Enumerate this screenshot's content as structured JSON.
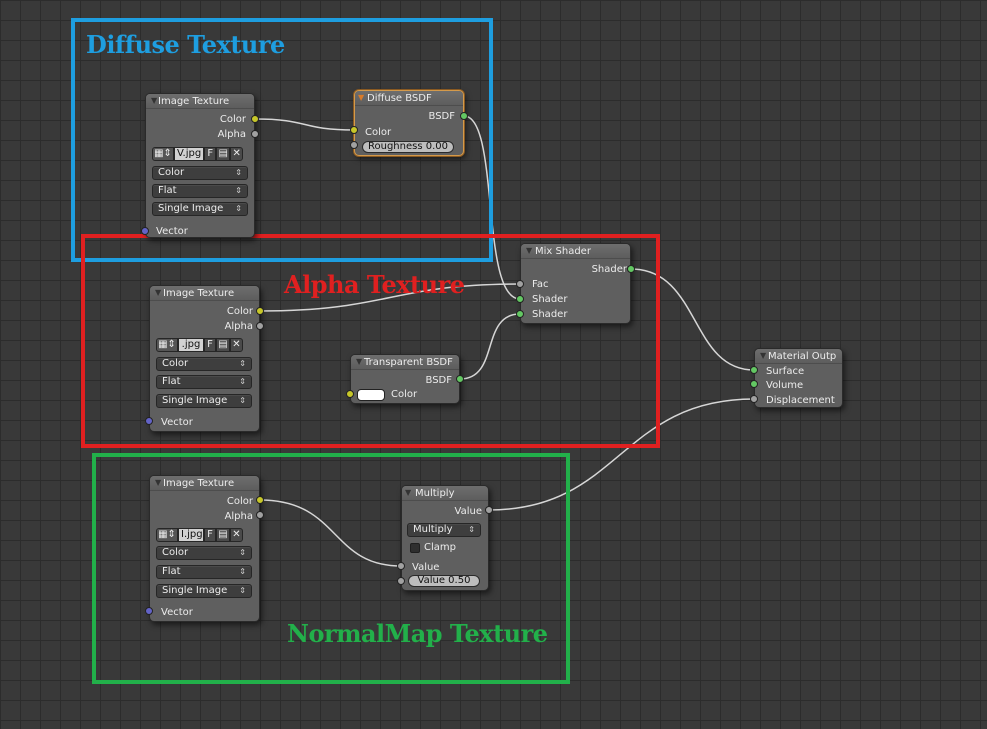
{
  "frames": {
    "diffuse": {
      "title": "Diffuse Texture",
      "color": "#1e9ee0"
    },
    "alpha": {
      "title": "Alpha Texture",
      "color": "#e02020"
    },
    "normal": {
      "title": "NormalMap Texture",
      "color": "#22b04a"
    }
  },
  "nodes": {
    "image_texture_1": {
      "title": "Image Texture",
      "outputs": {
        "color": "Color",
        "alpha": "Alpha"
      },
      "image_name": "V.jpg",
      "fake_user": "F",
      "color_space": "Color",
      "projection": "Flat",
      "source": "Single Image",
      "input_vector": "Vector"
    },
    "image_texture_2": {
      "title": "Image Texture",
      "outputs": {
        "color": "Color",
        "alpha": "Alpha"
      },
      "image_name": ".jpg",
      "fake_user": "F",
      "color_space": "Color",
      "projection": "Flat",
      "source": "Single Image",
      "input_vector": "Vector"
    },
    "image_texture_3": {
      "title": "Image Texture",
      "outputs": {
        "color": "Color",
        "alpha": "Alpha"
      },
      "image_name": "I.jpg",
      "fake_user": "F",
      "color_space": "Color",
      "projection": "Flat",
      "source": "Single Image",
      "input_vector": "Vector"
    },
    "diffuse_bsdf": {
      "title": "Diffuse BSDF",
      "output": "BSDF",
      "input_color": "Color",
      "roughness": "Roughness 0.00"
    },
    "mix_shader": {
      "title": "Mix Shader",
      "output": "Shader",
      "inputs": [
        "Fac",
        "Shader",
        "Shader"
      ]
    },
    "transparent_bsdf": {
      "title": "Transparent BSDF",
      "output": "BSDF",
      "input_color": "Color",
      "swatch_color": "#ffffff"
    },
    "material_output": {
      "title": "Material Outp",
      "inputs": [
        "Surface",
        "Volume",
        "Displacement"
      ]
    },
    "multiply": {
      "title": "Multiply",
      "output": "Value",
      "operation": "Multiply",
      "clamp": "Clamp",
      "input_value": "Value",
      "value_slider": "Value 0.50"
    }
  },
  "icons": {
    "image_browse": "image-icon",
    "open_file": "folder-icon",
    "unlink": "close-icon",
    "dropdown": "updown-arrow-icon",
    "collapse": "triangle-down-icon"
  },
  "socket_colors": {
    "color": "#c7c729",
    "float": "#a1a1a1",
    "shader": "#63c763",
    "vector": "#6363c7"
  }
}
